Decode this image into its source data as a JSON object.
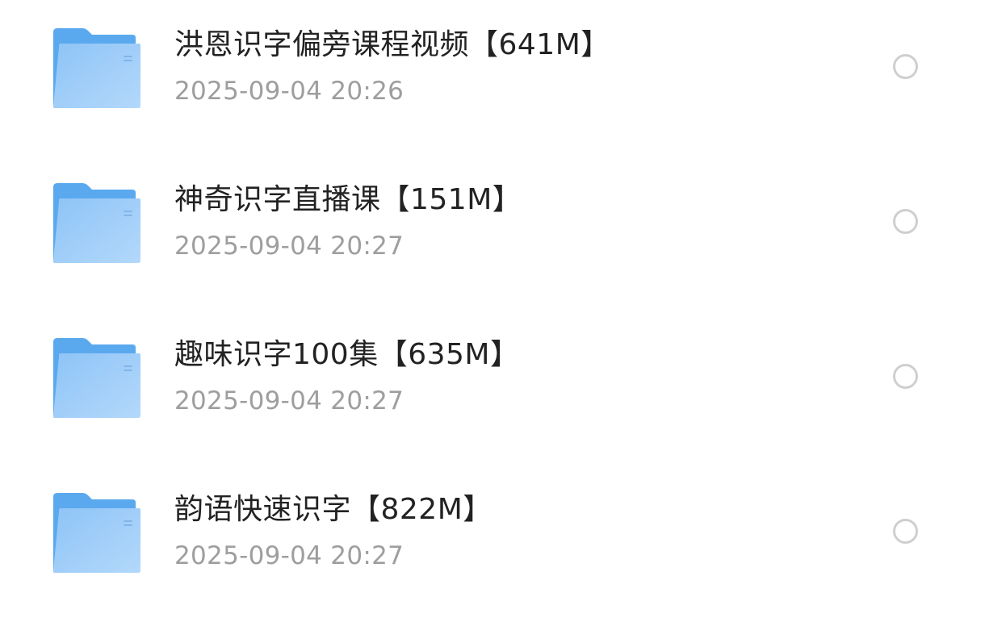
{
  "files": [
    {
      "name": "洪恩识字偏旁课程视频【641M】",
      "date": "2025-09-04 20:26",
      "icon": "folder-icon",
      "selected": false
    },
    {
      "name": "神奇识字直播课【151M】",
      "date": "2025-09-04 20:27",
      "icon": "folder-icon",
      "selected": false
    },
    {
      "name": "趣味识字100集【635M】",
      "date": "2025-09-04 20:27",
      "icon": "folder-icon",
      "selected": false
    },
    {
      "name": "韵语快速识字【822M】",
      "date": "2025-09-04 20:27",
      "icon": "folder-icon",
      "selected": false
    }
  ],
  "colors": {
    "folder_back": "#5aa9ef",
    "folder_front_start": "#8ec4f6",
    "folder_front_end": "#b3d8fb",
    "name_text": "#222222",
    "date_text": "#9e9e9e",
    "radio_border": "#cfcfcf"
  }
}
